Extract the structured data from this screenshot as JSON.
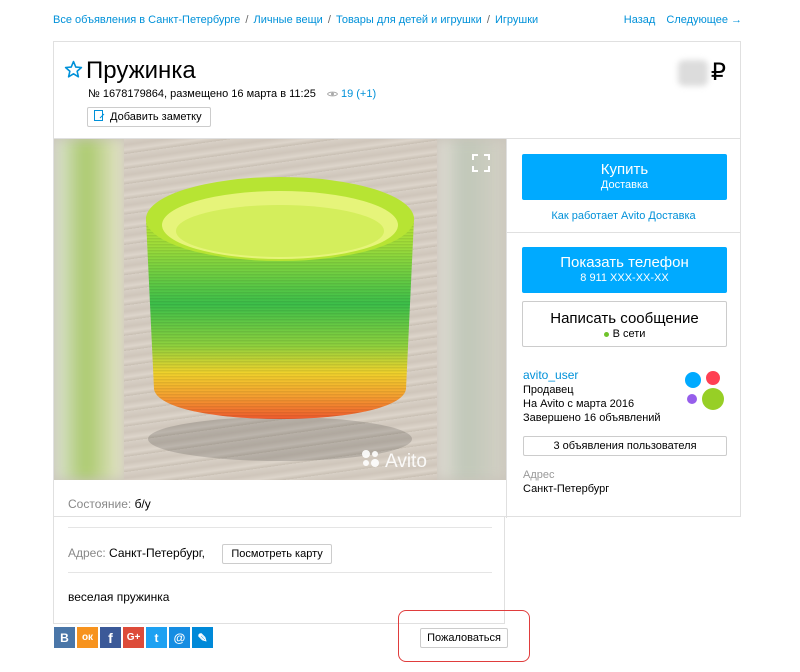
{
  "breadcrumbs": [
    "Все объявления в Санкт-Петербурге",
    "Личные вещи",
    "Товары для детей и игрушки",
    "Игрушки"
  ],
  "breadcrumb_sep": "/",
  "topnav": {
    "back": "Назад",
    "next": "Следующее →"
  },
  "listing": {
    "title": "Пружинка",
    "meta": "№ 1678179864, размещено 16 марта в 11:25",
    "views": "19 (+1)",
    "add_note": "Добавить заметку",
    "price_currency": "₽"
  },
  "photo": {
    "watermark": "Avito"
  },
  "details": {
    "condition_label": "Состояние:",
    "condition_value": "б/у",
    "address_label": "Адрес:",
    "address_value": "Санкт-Петербург,",
    "map_button": "Посмотреть карту",
    "description": "веселая пружинка"
  },
  "sidebar": {
    "buy_label": "Купить",
    "buy_sub": "Доставка",
    "delivery_link": "Как работает Avito Доставка",
    "phone_label": "Показать телефон",
    "phone_sub": "8 911 XXX-XX-XX",
    "message_label": "Написать сообщение",
    "online_status": "В сети",
    "seller_name": "avito_user",
    "seller_role": "Продавец",
    "seller_since": "На Avito с марта 2016",
    "seller_completed": "Завершено 16 объявлений",
    "listings_button": "3 объявления пользователя",
    "address_label": "Адрес",
    "address_value": "Санкт-Петербург"
  },
  "share": [
    {
      "icon": "vk-icon",
      "letter": "В",
      "color": "#4a76a8"
    },
    {
      "icon": "odnoklassniki-icon",
      "letter": "ок",
      "color": "#f7931e"
    },
    {
      "icon": "facebook-icon",
      "letter": "f",
      "color": "#3b5998"
    },
    {
      "icon": "google-plus-icon",
      "letter": "G+",
      "color": "#dd4b39"
    },
    {
      "icon": "twitter-icon",
      "letter": "t",
      "color": "#1da1f2"
    },
    {
      "icon": "mail-icon",
      "letter": "@",
      "color": "#168de2"
    },
    {
      "icon": "livejournal-icon",
      "letter": "✎",
      "color": "#0089d8"
    }
  ],
  "complain_button": "Пожаловаться",
  "colors": {
    "accent": "#00aaff",
    "link": "#0091d9",
    "highlight": "#e03d3d"
  }
}
